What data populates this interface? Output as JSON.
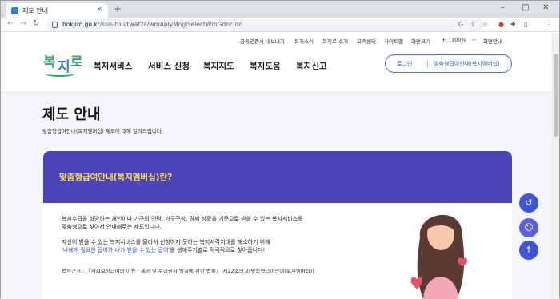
{
  "browser": {
    "tab_title": "제도 안내",
    "tab_close": "×",
    "new_tab": "+",
    "url_domain": "bokjiro.go.kr",
    "url_path": "/ssis-tbu/twatza/wmAplyMng/selectWmGdnc.do",
    "back": "←",
    "forward": "→",
    "reload": "↻",
    "minimize": "–",
    "maximize": "□",
    "close": "✕"
  },
  "header": {
    "util_links": [
      "공동인증서 내보내기",
      "복지소식",
      "복지로 소개",
      "고객센터",
      "사이트맵",
      "화면크기"
    ],
    "zoom_plus": "+",
    "zoom_value": "100%",
    "zoom_minus": "−",
    "zoom_reset": "화면안내",
    "logo": {
      "c1": "복",
      "c2": "지",
      "c3": "로"
    },
    "gnb": [
      "복지서비스",
      "서비스 신청",
      "복지지도",
      "복지도움",
      "복지신고"
    ],
    "login": "로그인",
    "membership": "맞춤형급여안내(복지멤버십)"
  },
  "main": {
    "title": "제도 안내",
    "subtitle": "맞춤형급여안내(복지멤버십) 제도에 대해 알려드립니다.",
    "card_question": "맞춤형급여안내(복지멤버십)란?",
    "para1_l1": "복지수급을 희망하는 개인이나 가구의 연령, 가구구성, 경제 상황을 기준으로 받을 수 있는 복지서비스를",
    "para1_l2": "맞춤형으로 찾아서 안내해주는 제도입니다.",
    "para2_l1": "자신이 받을 수 있는 복지서비스를 몰라서 신청하지 못하는 복지사각지대를 해소하기 위해",
    "para2_hl": "'나에게 필요한 급여와 내가 받을 수 있는 급여'",
    "para2_rest": "를 생애주기별로 적극적으로 찾아줍니다!",
    "law": "법적근거 : 「사회보장급여의 이용 · 제공 및 수급권자 발굴에 관한 법률」 제22조의 2(맞춤형급여안내(복지멤버십))"
  },
  "fabs": {
    "history": "↺",
    "chat": "☺",
    "top": "↑"
  },
  "colors": {
    "accent": "#4b43b8",
    "highlight": "#ffe14d",
    "link": "#2e5bd8",
    "brand_green": "#3aa66b"
  }
}
